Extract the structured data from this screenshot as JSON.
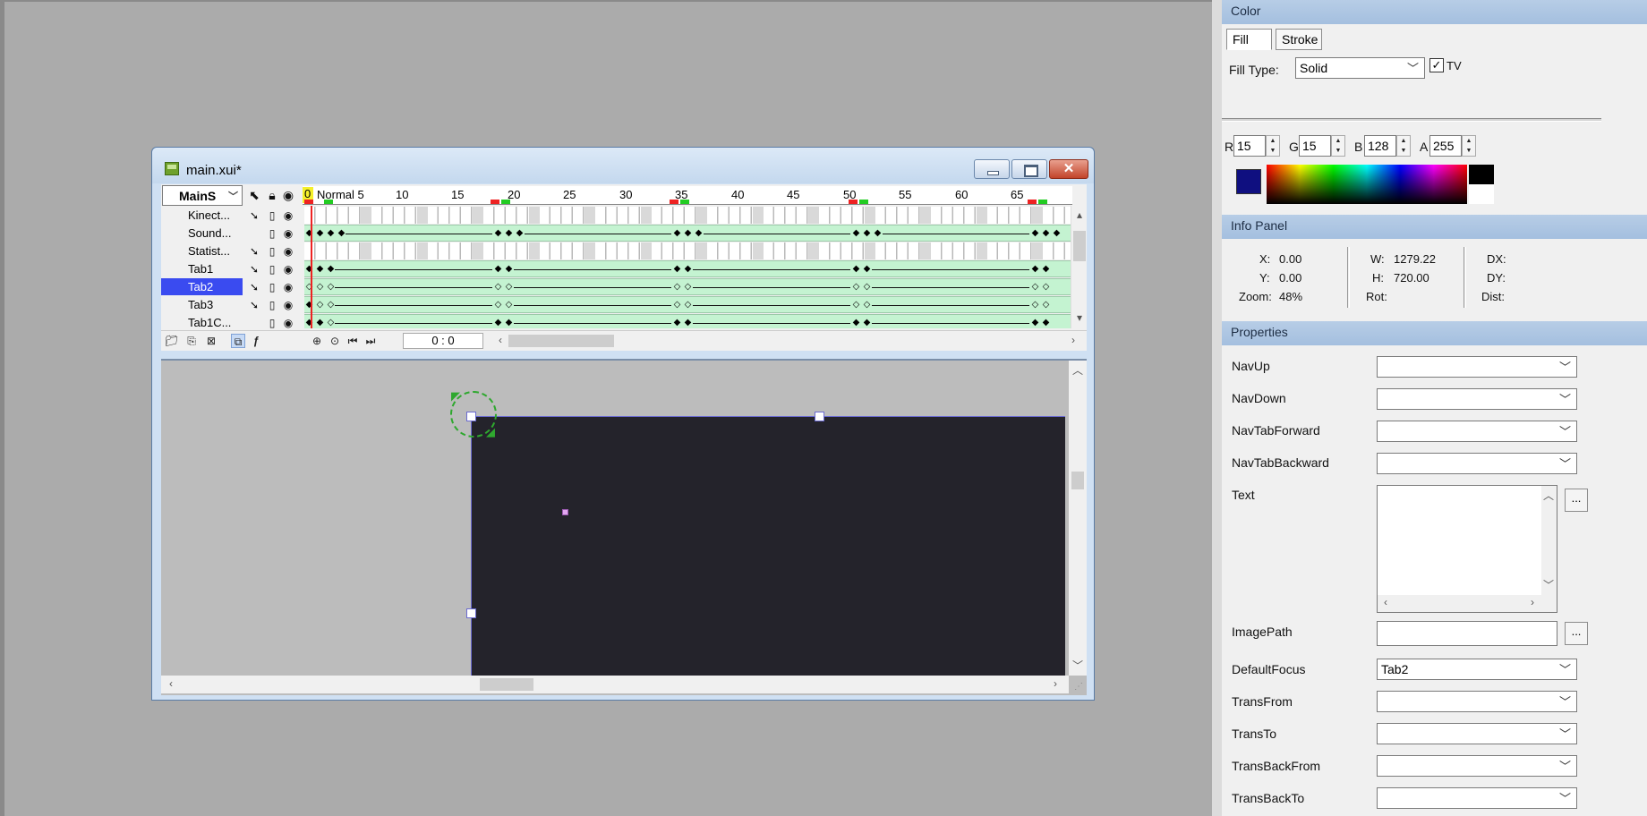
{
  "document": {
    "title": "main.xui*",
    "close_glyph": "✕"
  },
  "timeline": {
    "scene": "MainS",
    "ruler": [
      "0",
      "Normal 5",
      "10",
      "15",
      "20",
      "25",
      "30",
      "35",
      "40",
      "45",
      "50",
      "55",
      "60",
      "65"
    ],
    "layers": [
      "Kinect...",
      "Sound...",
      "Statist...",
      "Tab1",
      "Tab2",
      "Tab3",
      "Tab1C..."
    ],
    "selected_layer": "Tab2",
    "frame_counter": "0 : 0"
  },
  "colors": {
    "selection": "#3a4bf0",
    "tween": "#c4f3d1",
    "artboard": "#24232b",
    "fill_swatch": "#0f0f80",
    "panel_header": "#a4bfdf"
  },
  "color_panel": {
    "header": "Color",
    "tabs": [
      "Fill",
      "Stroke"
    ],
    "fill_type_label": "Fill Type:",
    "fill_type_value": "Solid",
    "tv_label": "TV",
    "tv_checked": true,
    "r_label": "R",
    "r": "15",
    "g_label": "G",
    "g": "15",
    "b_label": "B",
    "b": "128",
    "a_label": "A",
    "a": "255"
  },
  "info_panel": {
    "header": "Info Panel",
    "x_label": "X:",
    "x": "0.00",
    "y_label": "Y:",
    "y": "0.00",
    "zoom_label": "Zoom:",
    "zoom": "48%",
    "w_label": "W:",
    "w": "1279.22",
    "h_label": "H:",
    "h": "720.00",
    "rot_label": "Rot:",
    "dx_label": "DX:",
    "dy_label": "DY:",
    "dist_label": "Dist:"
  },
  "properties": {
    "header": "Properties",
    "nav_up": "NavUp",
    "nav_down": "NavDown",
    "nav_tab_forward": "NavTabForward",
    "nav_tab_backward": "NavTabBackward",
    "text": "Text",
    "image_path": "ImagePath",
    "default_focus": "DefaultFocus",
    "default_focus_value": "Tab2",
    "trans_from": "TransFrom",
    "trans_to": "TransTo",
    "trans_back_from": "TransBackFrom",
    "trans_back_to": "TransBackTo",
    "ellipsis": "..."
  }
}
